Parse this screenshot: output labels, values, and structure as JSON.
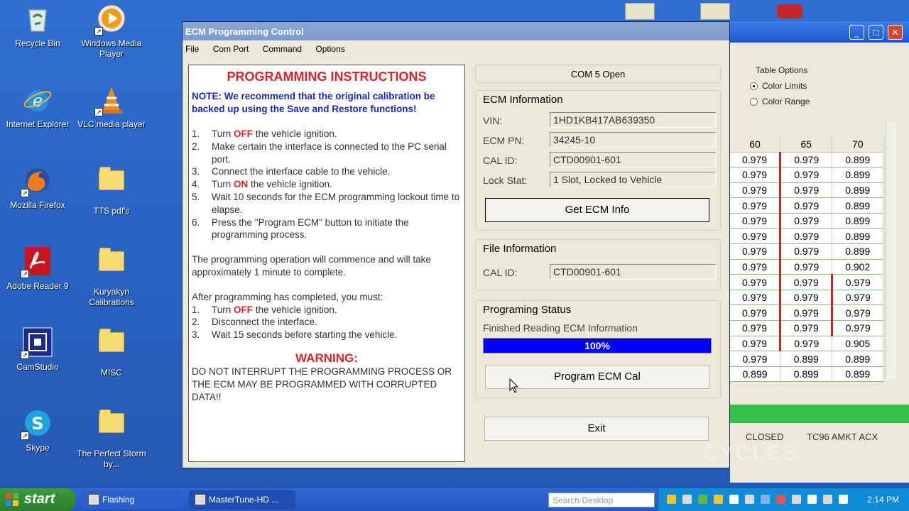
{
  "desktop_icons": [
    {
      "label": "Recycle Bin"
    },
    {
      "label": "Windows Media Player"
    },
    {
      "label": "Internet Explorer"
    },
    {
      "label": "VLC media player"
    },
    {
      "label": "Mozilla Firefox"
    },
    {
      "label": "TTS pdf's"
    },
    {
      "label": "Adobe Reader 9"
    },
    {
      "label": "Kuryakyn Calibrations"
    },
    {
      "label": "CamStudio"
    },
    {
      "label": "MISC"
    },
    {
      "label": "Skype"
    },
    {
      "label": "The Perfect Storm by..."
    }
  ],
  "dialog": {
    "title": "ECM Programming Control",
    "menu": [
      "File",
      "Com Port",
      "Command",
      "Options"
    ],
    "instructions": {
      "heading": "PROGRAMMING INSTRUCTIONS",
      "note": "NOTE:  We recommend that the original calibration be backed up using the Save and Restore functions!",
      "steps": [
        {
          "n": "1.",
          "pre": "Turn ",
          "em": "OFF",
          "post": " the vehicle ignition."
        },
        {
          "n": "2.",
          "pre": "Make certain the interface is connected to the PC serial port.",
          "em": "",
          "post": ""
        },
        {
          "n": "3.",
          "pre": "Connect the interface cable to the vehicle.",
          "em": "",
          "post": ""
        },
        {
          "n": "4.",
          "pre": "Turn ",
          "em": "ON",
          "post": " the vehicle ignition."
        },
        {
          "n": "5.",
          "pre": "Wait 10 seconds for the ECM programming lockout time to elapse.",
          "em": "",
          "post": ""
        },
        {
          "n": "6.",
          "pre": "Press the \"Program ECM\" button to initiate the programming process.",
          "em": "",
          "post": ""
        }
      ],
      "para1": "The programming operation will commence and will take approximately 1 minute to complete.",
      "para2": "After programming has completed, you must:",
      "steps2": [
        {
          "n": "1.",
          "pre": "Turn ",
          "em": "OFF",
          "post": " the vehicle ignition."
        },
        {
          "n": "2.",
          "pre": "Disconnect the interface.",
          "em": "",
          "post": ""
        },
        {
          "n": "3.",
          "pre": "Wait 15 seconds before starting the vehicle.",
          "em": "",
          "post": ""
        }
      ],
      "warning_title": "WARNING:",
      "warning_text": "DO NOT INTERRUPT THE PROGRAMMING PROCESS OR THE ECM MAY BE PROGRAMMED WITH CORRUPTED DATA!!"
    },
    "com_status": "COM 5 Open",
    "ecm_info": {
      "legend": "ECM Information",
      "vin_label": "VIN:",
      "vin": "1HD1KB417AB639350",
      "pn_label": "ECM PN:",
      "pn": "34245-10",
      "cal_label": "CAL ID:",
      "cal": "CTD00901-601",
      "lock_label": "Lock Stat:",
      "lock": "1 Slot, Locked to Vehicle",
      "button": "Get ECM Info"
    },
    "file_info": {
      "legend": "File Information",
      "cal_label": "CAL ID:",
      "cal": "CTD00901-601"
    },
    "status": {
      "legend": "Programing Status",
      "message": "Finished Reading ECM Information",
      "progress_text": "100%",
      "progress_value": 1.0,
      "button": "Program ECM Cal"
    },
    "exit_button": "Exit"
  },
  "bg_window": {
    "table_options_title": "Table Options",
    "options": [
      {
        "label": "Color Limits",
        "selected": true
      },
      {
        "label": "Color Range",
        "selected": false
      }
    ],
    "columns": [
      "60",
      "65",
      "70"
    ],
    "rows": [
      [
        "0.979",
        "0.979",
        "0.899"
      ],
      [
        "0.979",
        "0.979",
        "0.899"
      ],
      [
        "0.979",
        "0.979",
        "0.899"
      ],
      [
        "0.979",
        "0.979",
        "0.899"
      ],
      [
        "0.979",
        "0.979",
        "0.899"
      ],
      [
        "0.979",
        "0.979",
        "0.899"
      ],
      [
        "0.979",
        "0.979",
        "0.899"
      ],
      [
        "0.979",
        "0.979",
        "0.902"
      ],
      [
        "0.979",
        "0.979",
        "0.979"
      ],
      [
        "0.979",
        "0.979",
        "0.979"
      ],
      [
        "0.979",
        "0.979",
        "0.979"
      ],
      [
        "0.979",
        "0.979",
        "0.979"
      ],
      [
        "0.979",
        "0.979",
        "0.905"
      ],
      [
        "0.979",
        "0.899",
        "0.899"
      ],
      [
        "0.899",
        "0.899",
        "0.899"
      ]
    ],
    "status_left": "CLOSED",
    "status_right": "TC96 AMKT ACX"
  },
  "taskbar": {
    "start_label": "start",
    "tasks": [
      "Flashing",
      "MasterTune-HD ..."
    ],
    "search_placeholder": "Search Desktop",
    "clock": "2:14 PM"
  },
  "watermark": "CYCLES",
  "colors": {
    "accent_red": "#d8242b",
    "note_blue": "#1a28b8",
    "progress_blue": "#0000ff",
    "grid_green": "#87c77a"
  }
}
